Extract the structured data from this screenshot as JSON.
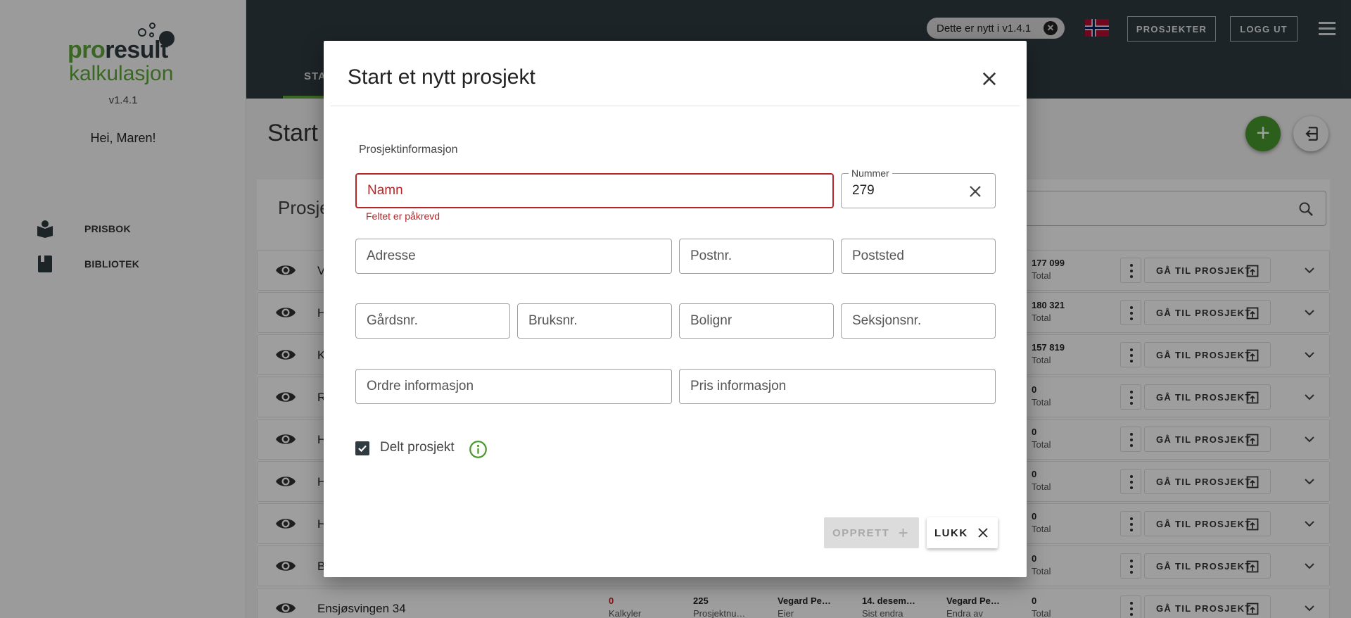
{
  "app": {
    "logo_pro": "pro",
    "logo_result": "result",
    "logo_sub": "kalkulasjon",
    "version": "v1.4.1",
    "greeting": "Hei, Maren!"
  },
  "sidebar": {
    "items": [
      {
        "label": "PRISBOK",
        "icon": "price-book-icon"
      },
      {
        "label": "BIBLIOTEK",
        "icon": "library-icon"
      }
    ]
  },
  "topbar": {
    "news_chip": "Dette er nytt i v1.4.1",
    "projects_button": "PROSJEKTER",
    "logout_button": "LOGG UT",
    "tab_start": "STA"
  },
  "main": {
    "title": "Start",
    "section_title": "Prosje",
    "goto_label": "GÅ TIL PROSJEKT",
    "rows": [
      {
        "name": "V",
        "total": "177 099",
        "total_label": "Total"
      },
      {
        "name": "H",
        "total": "180 321",
        "total_label": "Total"
      },
      {
        "name": "K",
        "total": "157 819",
        "total_label": "Total"
      },
      {
        "name": "R",
        "total": "0",
        "total_label": "Total"
      },
      {
        "name": "H",
        "total": "0",
        "total_label": "Total"
      },
      {
        "name": "H",
        "total": "0",
        "total_label": "Total"
      },
      {
        "name": "H",
        "total": "0",
        "total_label": "Total"
      },
      {
        "name": "B",
        "total": "0",
        "total_label": "Total"
      },
      {
        "name": "Ensjøsvingen 34",
        "total": "0",
        "total_label": "Total",
        "calc_value": "0",
        "calc_label": "Kalkyler",
        "projnum_value": "225",
        "projnum_label": "Prosjektnu…",
        "owner_value": "Vegard Pe…",
        "owner_label": "Eier",
        "changed_value": "14. desem…",
        "changed_label": "Sist endra",
        "changedby_value": "Vegard Pe…",
        "changedby_label": "Endra av"
      }
    ]
  },
  "dialog": {
    "title": "Start et nytt prosjekt",
    "section_label": "Prosjektinformasjon",
    "name_placeholder": "Namn",
    "name_error": "Feltet er påkrevd",
    "number_label": "Nummer",
    "number_value": "279",
    "address_placeholder": "Adresse",
    "postnr_placeholder": "Postnr.",
    "poststed_placeholder": "Poststed",
    "gardsnr_placeholder": "Gårdsnr.",
    "bruksnr_placeholder": "Bruksnr.",
    "bolignr_placeholder": "Bolignr",
    "seksjonsnr_placeholder": "Seksjonsnr.",
    "order_info_placeholder": "Ordre informasjon",
    "price_info_placeholder": "Pris informasjon",
    "shared_label": "Delt prosjekt",
    "shared_checked": true,
    "create_button": "OPPRETT",
    "close_button": "LUKK"
  },
  "colors": {
    "brand_green": "#5fa63a",
    "topbar": "#2f3b41",
    "error": "#b3262a"
  }
}
